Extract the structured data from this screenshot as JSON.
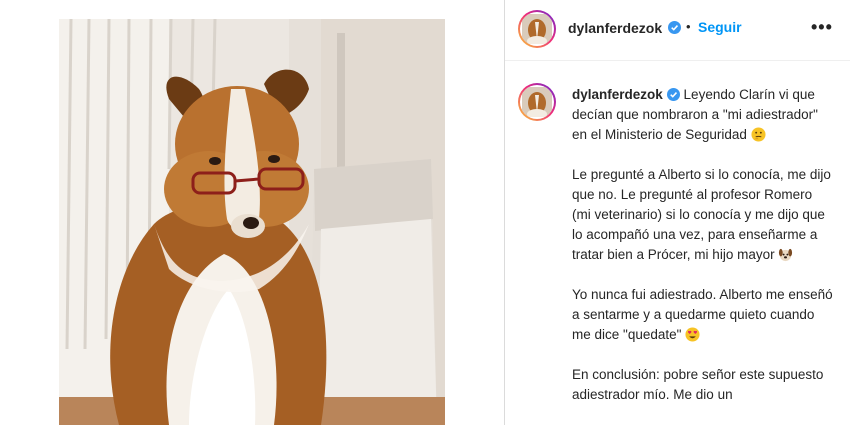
{
  "post": {
    "username": "dylanferdezok",
    "follow_label": "Seguir",
    "separator": "•",
    "more_label": "•••",
    "icons": {
      "verified": "verified-badge-icon",
      "more": "more-options-icon",
      "emoji_thinking": "thinking-face-emoji",
      "emoji_dog": "dog-face-emoji",
      "emoji_heart_eyes": "heart-eyes-emoji"
    },
    "colors": {
      "follow": "#0095f6",
      "verified": "#3897f0",
      "text": "#262626"
    }
  },
  "caption": {
    "p1": "Leyendo Clarín vi que decían que nombraron a \"mi adiestrador\" en el Ministerio de Seguridad",
    "p2": "Le pregunté a Alberto si lo conocía, me dijo que no. Le pregunté al profesor Romero (mi veterinario) si lo conocía y me dijo que lo acompañó una vez, para enseñarme a tratar bien a Prócer, mi hijo mayor",
    "p3": "Yo nunca fui adiestrado. Alberto me enseñó a sentarme y a quedarme quieto cuando me dice \"quedate\"",
    "p4": "En conclusión: pobre señor este supuesto adiestrador mío. Me dio un"
  }
}
